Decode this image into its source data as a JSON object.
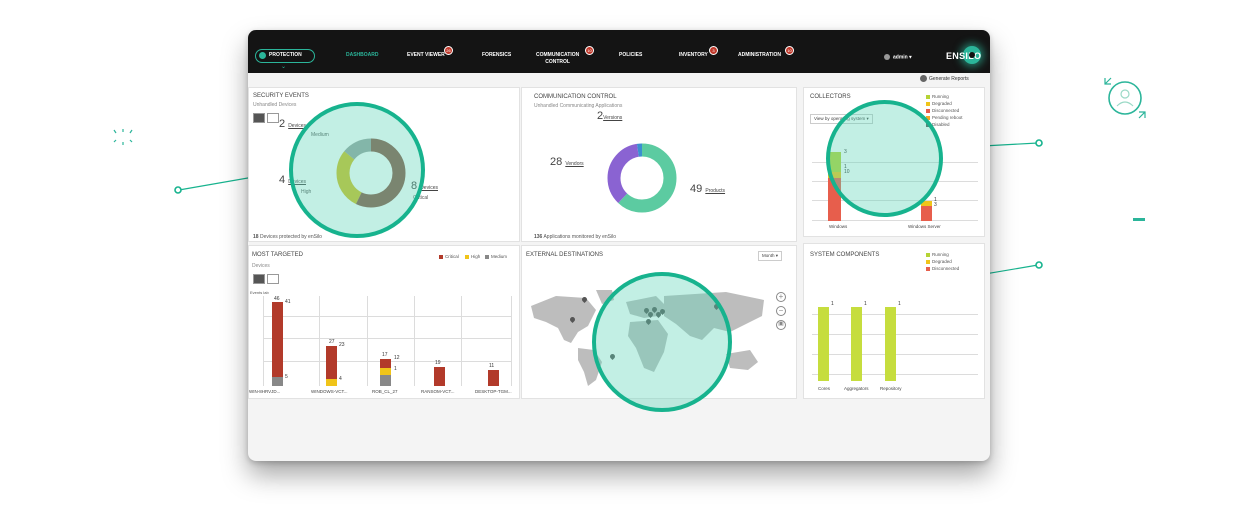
{
  "nav": {
    "protection": "PROTECTION",
    "items": [
      {
        "label": "DASHBOARD",
        "badge": ""
      },
      {
        "label": "EVENT VIEWER",
        "badge": "26"
      },
      {
        "label": "FORENSICS",
        "badge": ""
      },
      {
        "label": "COMMUNICATION",
        "label2": "CONTROL",
        "badge": "10"
      },
      {
        "label": "POLICIES",
        "badge": ""
      },
      {
        "label": "INVENTORY",
        "badge": "3"
      },
      {
        "label": "ADMINISTRATION",
        "badge": "10"
      }
    ],
    "user": "admin",
    "logo": "ENSILO",
    "generate_reports": "Generate Reports"
  },
  "security_events": {
    "title": "SECURITY EVENTS",
    "subtitle": "Unhandled Devices",
    "medium_value": "2",
    "medium_label": "Devices",
    "medium_sub": "Medium",
    "high_value": "4",
    "high_label": "Devices",
    "high_sub": "High",
    "critical_value": "8",
    "critical_label": "Devices",
    "critical_sub": "Critical",
    "footer_num": "18",
    "footer_text": "Devices protected by enSilo"
  },
  "communication_control": {
    "title": "COMMUNICATION CONTROL",
    "subtitle": "Unhandled Communicating Applications",
    "versions_value": "2",
    "versions_label": "Versions",
    "vendors_value": "28",
    "vendors_label": "Vendors",
    "products_value": "49",
    "products_label": "Products",
    "footer_num": "136",
    "footer_text": "Applications monitored by enSilo"
  },
  "collectors": {
    "title": "COLLECTORS",
    "select": "View by operating system",
    "legend": [
      "Running",
      "Degraded",
      "Disconnected",
      "Pending reboot",
      "Disabled"
    ],
    "categories": [
      "Windows",
      "Windows Server"
    ],
    "labels": [
      "3",
      "1",
      "10",
      "1",
      "3"
    ]
  },
  "most_targeted": {
    "title": "MOST TARGETED",
    "subtitle": "Devices",
    "axis_label": "Events lab",
    "legend": [
      "Critical",
      "High",
      "Medium"
    ],
    "categories": [
      "WIN-8HRVJD...",
      "WINDOWS-VCT...",
      "ROB_CL_27",
      "RANSOM-VCT...",
      "DESKTOP-TGM..."
    ],
    "labels": [
      "46",
      "41",
      "5",
      "27",
      "23",
      "4",
      "17",
      "12",
      "1",
      "19",
      "11"
    ]
  },
  "external_destinations": {
    "title": "EXTERNAL DESTINATIONS",
    "period": "Month"
  },
  "system_components": {
    "title": "SYSTEM COMPONENTS",
    "legend": [
      "Running",
      "Degraded",
      "Disconnected"
    ],
    "categories": [
      "Cores",
      "Aggregators",
      "Repository"
    ],
    "labels": [
      "1",
      "1",
      "1"
    ]
  },
  "colors": {
    "accent": "#2bb59a",
    "critical": "#b23a2a",
    "high": "#f0c419",
    "medium": "#888888",
    "running": "#b5d335",
    "disconnected": "#e75e4c"
  },
  "chart_data": [
    {
      "type": "pie",
      "title": "SECURITY EVENTS",
      "categories": [
        "Critical",
        "High",
        "Medium"
      ],
      "values": [
        8,
        4,
        2
      ]
    },
    {
      "type": "pie",
      "title": "COMMUNICATION CONTROL",
      "categories": [
        "Products",
        "Vendors",
        "Versions"
      ],
      "values": [
        49,
        28,
        2
      ]
    },
    {
      "type": "bar",
      "title": "COLLECTORS",
      "categories": [
        "Windows",
        "Windows Server"
      ],
      "series": [
        {
          "name": "Disconnected",
          "values": [
            10,
            3
          ]
        },
        {
          "name": "Degraded",
          "values": [
            1,
            1
          ]
        },
        {
          "name": "Running",
          "values": [
            3,
            0
          ]
        }
      ]
    },
    {
      "type": "bar",
      "title": "MOST TARGETED",
      "categories": [
        "WIN-8HRVJD...",
        "WINDOWS-VCT...",
        "ROB_CL_27",
        "RANSOM-VCT...",
        "DESKTOP-TGM..."
      ],
      "series": [
        {
          "name": "Critical",
          "values": [
            41,
            23,
            12,
            19,
            11
          ]
        },
        {
          "name": "High",
          "values": [
            0,
            4,
            4,
            0,
            0
          ]
        },
        {
          "name": "Medium",
          "values": [
            5,
            0,
            1,
            0,
            0
          ]
        }
      ]
    },
    {
      "type": "bar",
      "title": "SYSTEM COMPONENTS",
      "categories": [
        "Cores",
        "Aggregators",
        "Repository"
      ],
      "series": [
        {
          "name": "Running",
          "values": [
            1,
            1,
            1
          ]
        }
      ]
    }
  ]
}
